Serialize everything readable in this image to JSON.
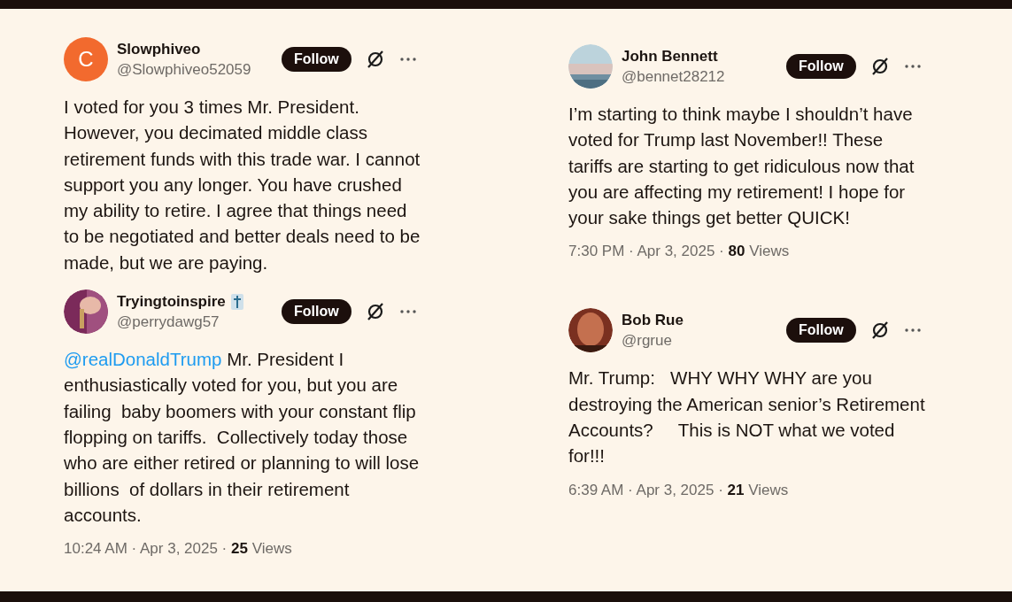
{
  "columns": [
    {
      "tweets": [
        {
          "name": "Slowphiveo",
          "handle": "@Slowphiveo52059",
          "avatar": {
            "kind": "letter",
            "letter": "C",
            "color": "#f26a2e"
          },
          "follow": "Follow",
          "text": "I voted for you 3 times Mr. President. However, you decimated middle class retirement funds with this trade war. I cannot support you any longer. You have crushed my ability to retire. I agree that things need to be negotiated and better deals need to be made, but we are paying."
        },
        {
          "name": "Tryingtoinspire",
          "handle": "@perrydawg57",
          "badge": true,
          "follow": "Follow",
          "mention": "@realDonaldTrump",
          "text": "Mr. President I enthusiastically voted for you, but you are failing  baby boomers with your constant flip flopping on tariffs.  Collectively today those who are either retired or planning to will lose billions  of dollars in their retirement accounts.",
          "stats": "10:24 AM · Apr 3, 2025 · **25** Views"
        }
      ]
    },
    {
      "tweets": [
        {
          "name": "John Bennett",
          "handle": "@bennet28212",
          "follow": "Follow",
          "text": "I’m starting to think maybe I shouldn’t have voted for Trump last November!! These tariffs are starting to get ridiculous now that you are affecting my retirement! I hope for your sake things get better QUICK!",
          "stats": "7:30 PM · Apr 3, 2025 · **80** Views"
        },
        {
          "name": "Bob Rue",
          "handle": "@rgrue",
          "follow": "Follow",
          "text": "Mr. Trump:   WHY WHY WHY are you destroying the American senior’s Retirement Accounts?     This is NOT what we voted for!!!",
          "stats": "6:39 AM · Apr 3, 2025 · **21** Views"
        }
      ]
    }
  ]
}
